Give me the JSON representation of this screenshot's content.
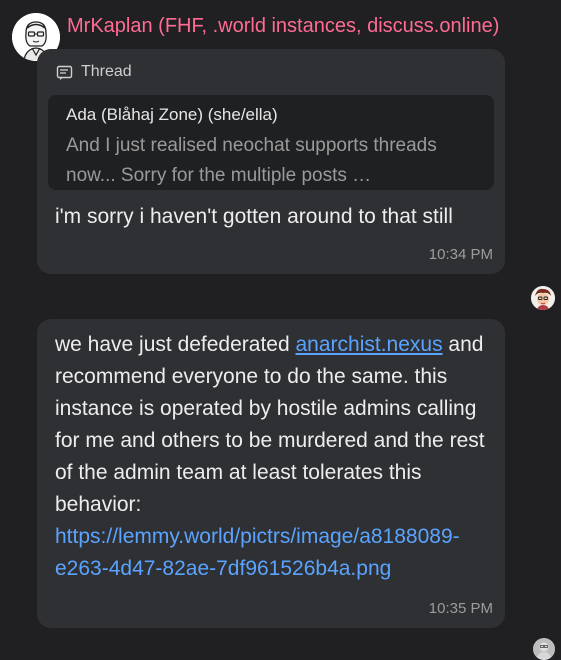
{
  "sender": {
    "name": "MrKaplan (FHF, .world instances, discuss.online)",
    "name_color": "#ff6b93"
  },
  "messages": [
    {
      "thread_label": "Thread",
      "thread_icon": "thread-icon",
      "quote": {
        "author": "Ada (Blåhaj Zone) (she/ella)",
        "text": "And I just realised neochat supports threads now... Sorry for the multiple posts …"
      },
      "body": "i'm sorry i haven't gotten around to that still",
      "time": "10:34 PM"
    },
    {
      "body_before_link": "we have just defederated ",
      "link_text": "anarchist.nexus",
      "body_after_link": " and recommend everyone to do the same. this instance is operated by hostile admins calling for me and others to be murdered and the rest of the admin team at least tolerates this behavior: ",
      "url_text": "https://lemmy.world/pictrs/image/a8188089-e263-4d47-82ae-7df961526b4a.png",
      "time": "10:35 PM"
    }
  ],
  "colors": {
    "background": "#202023",
    "bubble": "#2f3033",
    "link": "#5aa4ff"
  }
}
